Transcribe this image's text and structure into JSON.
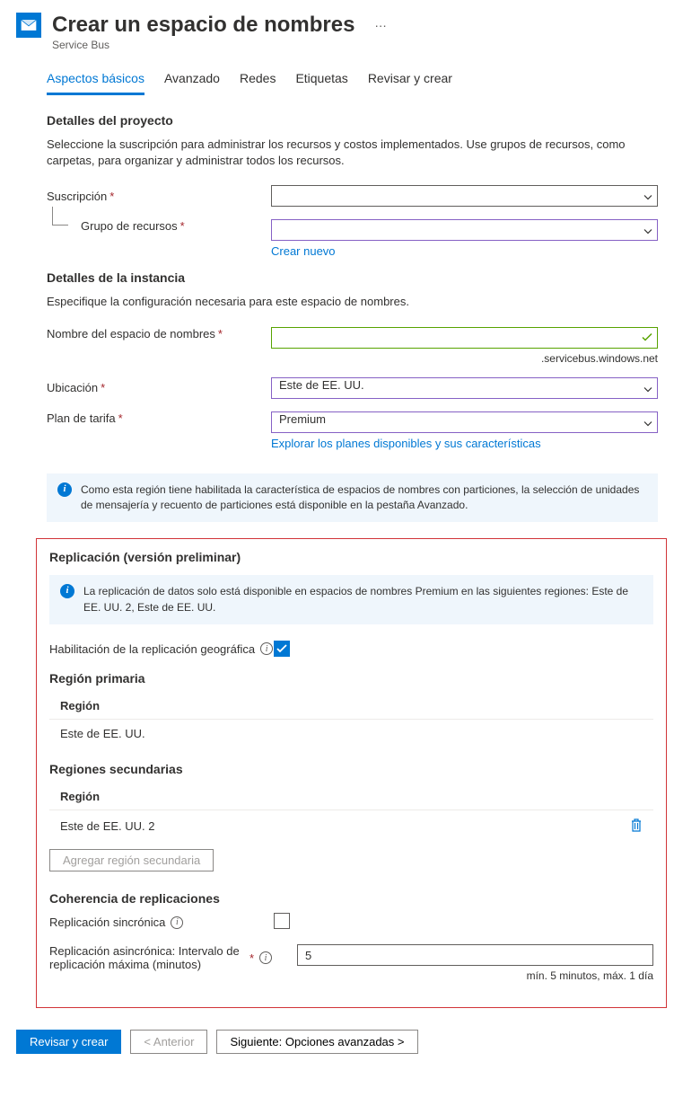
{
  "header": {
    "title": "Crear un espacio de nombres",
    "subtitle": "Service Bus",
    "more": "…"
  },
  "tabs": {
    "basics": "Aspectos básicos",
    "advanced": "Avanzado",
    "networks": "Redes",
    "tags": "Etiquetas",
    "review": "Revisar y crear"
  },
  "project": {
    "title": "Detalles del proyecto",
    "desc": "Seleccione la suscripción para administrar los recursos y costos implementados. Use grupos de recursos, como carpetas, para organizar y administrar todos los recursos.",
    "subscription_label": "Suscripción",
    "subscription_value": "",
    "resource_group_label": "Grupo de recursos",
    "resource_group_value": "",
    "create_new": "Crear nuevo"
  },
  "instance": {
    "title": "Detalles de la instancia",
    "desc": "Especifique la configuración necesaria para este espacio de nombres.",
    "namespace_label": "Nombre del espacio de nombres",
    "namespace_value": "",
    "namespace_suffix": ".servicebus.windows.net",
    "location_label": "Ubicación",
    "location_value": "Este de EE. UU.",
    "pricing_label": "Plan de tarifa",
    "pricing_value": "Premium",
    "explore_link": "Explorar los planes disponibles y sus características"
  },
  "info_partitions": "Como esta región tiene habilitada la característica de espacios de nombres con particiones, la selección de unidades de mensajería y recuento de particiones está disponible en la pestaña Avanzado.",
  "replication": {
    "title": "Replicación (versión preliminar)",
    "info": "La replicación de datos solo está disponible en espacios de nombres Premium en las siguientes regiones: Este de EE. UU. 2, Este de EE. UU.",
    "enable_label": "Habilitación de la replicación geográfica",
    "primary_title": "Región primaria",
    "region_header": "Región",
    "primary_value": "Este de EE. UU.",
    "secondary_title": "Regiones secundarias",
    "secondary_value": "Este de EE. UU. 2",
    "add_secondary": "Agregar región secundaria",
    "consistency_title": "Coherencia de replicaciones",
    "sync_label": "Replicación sincrónica",
    "async_label": "Replicación asincrónica: Intervalo de replicación máxima (minutos)",
    "async_value": "5",
    "async_hint": "mín. 5 minutos, máx. 1 día"
  },
  "footer": {
    "review": "Revisar y crear",
    "previous": "< Anterior",
    "next": "Siguiente: Opciones avanzadas >"
  }
}
